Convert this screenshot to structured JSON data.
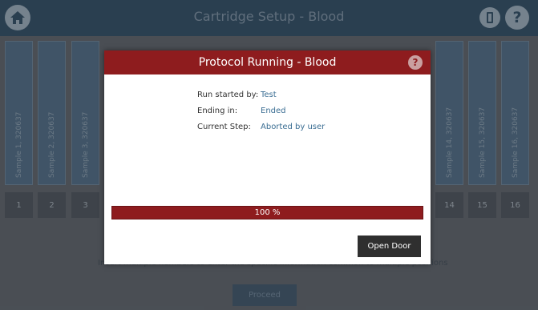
{
  "app": {
    "title": "Cartridge Setup - Blood"
  },
  "icons": {
    "home": "home-icon",
    "door": "door-icon",
    "help": "help-icon"
  },
  "columns": [
    "Sample 1, 320637",
    "Sample 2, 320637",
    "Sample 3, 320637",
    "Sample 14, 320637",
    "Sample 15, 320637",
    "Sample 16, 320637"
  ],
  "numbers": [
    "1",
    "2",
    "3",
    "14",
    "15",
    "16"
  ],
  "hint_text": "Insert multiple numbers to enter the specific information common to multiple positions",
  "proceed_label": "Proceed",
  "modal": {
    "title": "Protocol Running - Blood",
    "help_label": "?",
    "run_started_label": "Run started by:",
    "run_started_value": "Test",
    "ending_label": "Ending in:",
    "ending_value": "Ended",
    "step_label": "Current Step:",
    "step_value": "Aborted by user",
    "progress_percent": 100,
    "progress_text": "100 %",
    "open_door_label": "Open Door"
  },
  "colors": {
    "accent": "#8e1c1e",
    "topbar": "#2c4a61",
    "link_value": "#3b6e93"
  }
}
